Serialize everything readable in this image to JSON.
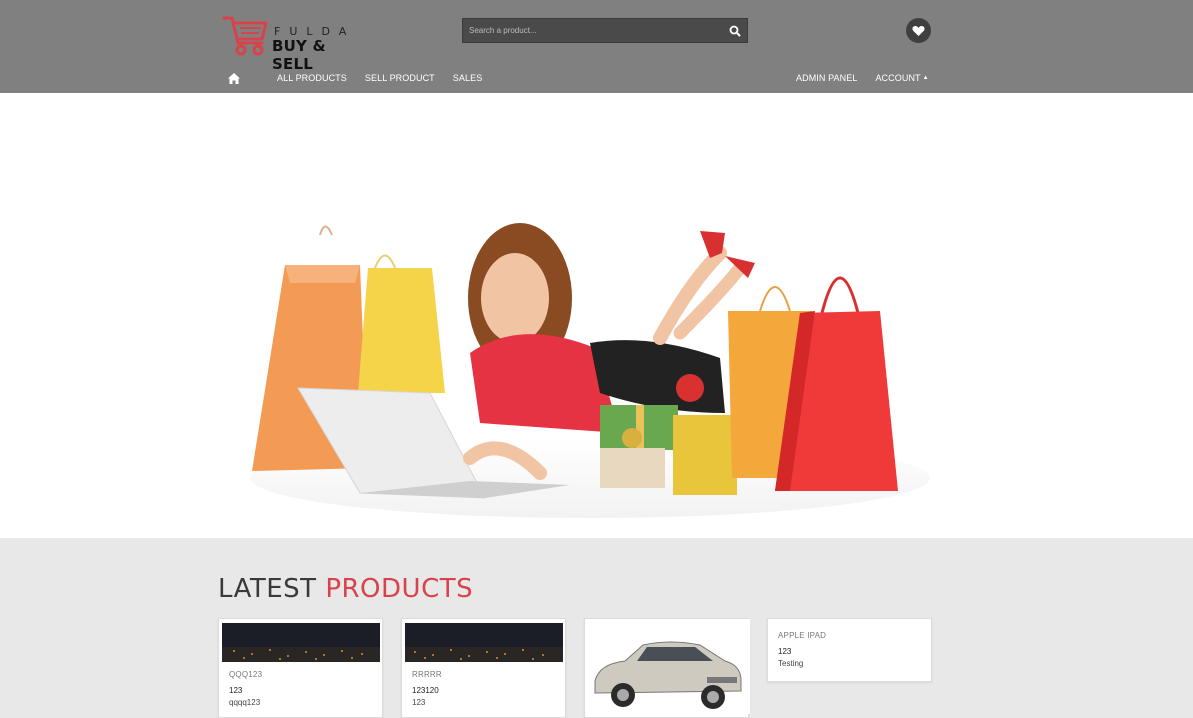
{
  "brand": {
    "line1": "FULDA",
    "line2": "BUY & SELL",
    "accent": "#d8434b"
  },
  "search": {
    "placeholder": "Search a product...",
    "icon": "search-icon"
  },
  "header": {
    "favorites_icon": "heart-icon",
    "background": "#808080"
  },
  "nav": {
    "home_icon": "home-icon",
    "left": [
      "ALL PRODUCTS",
      "SELL PRODUCT",
      "SALES"
    ],
    "right": [
      "ADMIN PANEL",
      "ACCOUNT"
    ],
    "account_caret": "▲"
  },
  "latest": {
    "title_part1": "LATEST",
    "title_part2": "PRODUCTS",
    "products": [
      {
        "name": "QQQ123",
        "price": "123",
        "desc": "qqqq123"
      },
      {
        "name": "RRRRR",
        "price": "123120",
        "desc": "123"
      },
      {
        "name": "",
        "price": "",
        "desc": ""
      },
      {
        "name": "APPLE IPAD",
        "price": "123",
        "desc": "Testing"
      }
    ]
  }
}
